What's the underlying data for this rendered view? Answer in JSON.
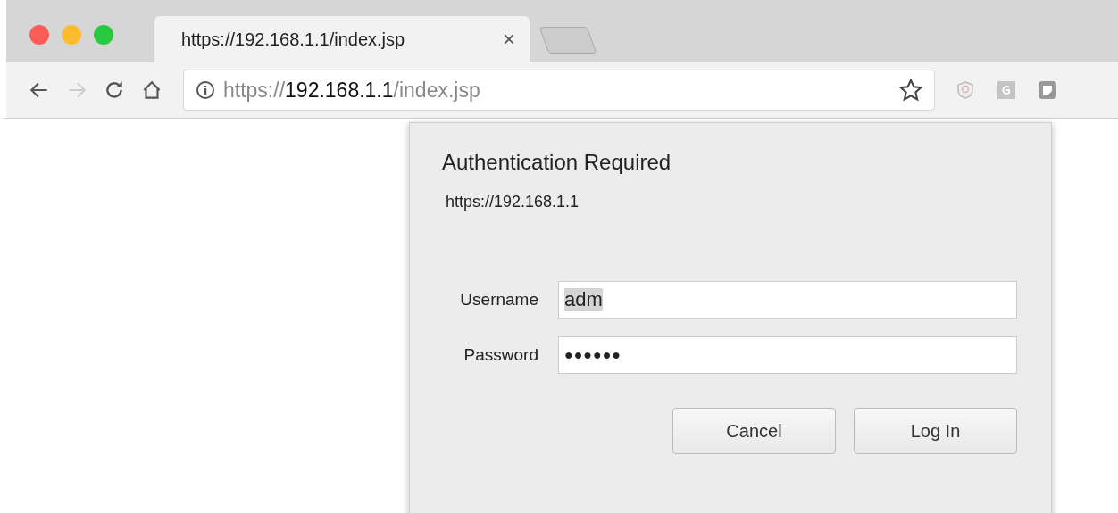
{
  "tab": {
    "title": "https://192.168.1.1/index.jsp",
    "close": "×",
    "selected": true
  },
  "toolbar": {
    "back_enabled": true,
    "forward_enabled": false,
    "address": "https://**192.168.1.1**/index.jsp"
  },
  "dialog": {
    "title": "Authentication Required",
    "origin": "https://192.168.1.1",
    "fields": [
      {
        "kind": "text",
        "label": "Username",
        "value": "adm",
        "value_selected": true
      },
      {
        "kind": "password",
        "label": "Password",
        "value": "●●●●●●",
        "value_selected": false
      }
    ],
    "buttons": [
      "Cancel",
      "Log In"
    ]
  }
}
